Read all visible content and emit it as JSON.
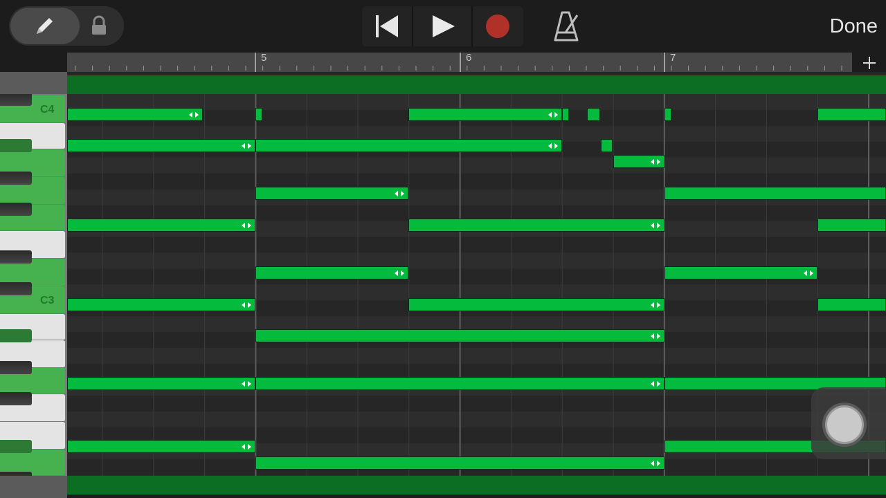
{
  "toolbar": {
    "edit_tool_icon": "pencil-icon",
    "lock_icon": "lock-icon",
    "rewind_icon": "go-to-beginning-icon",
    "play_icon": "play-icon",
    "record_icon": "record-icon",
    "record_color": "#b0302a",
    "metronome_icon": "metronome-icon",
    "done_label": "Done"
  },
  "ruler": {
    "bar_labels": [
      "5",
      "6",
      "7"
    ],
    "add_label": "+"
  },
  "keyboard": {
    "labels": {
      "c4": "C4",
      "c3": "C3"
    },
    "lit_color": "#45b24f"
  },
  "notes_color": "#05bb3e",
  "region_color": "#0c6e22"
}
